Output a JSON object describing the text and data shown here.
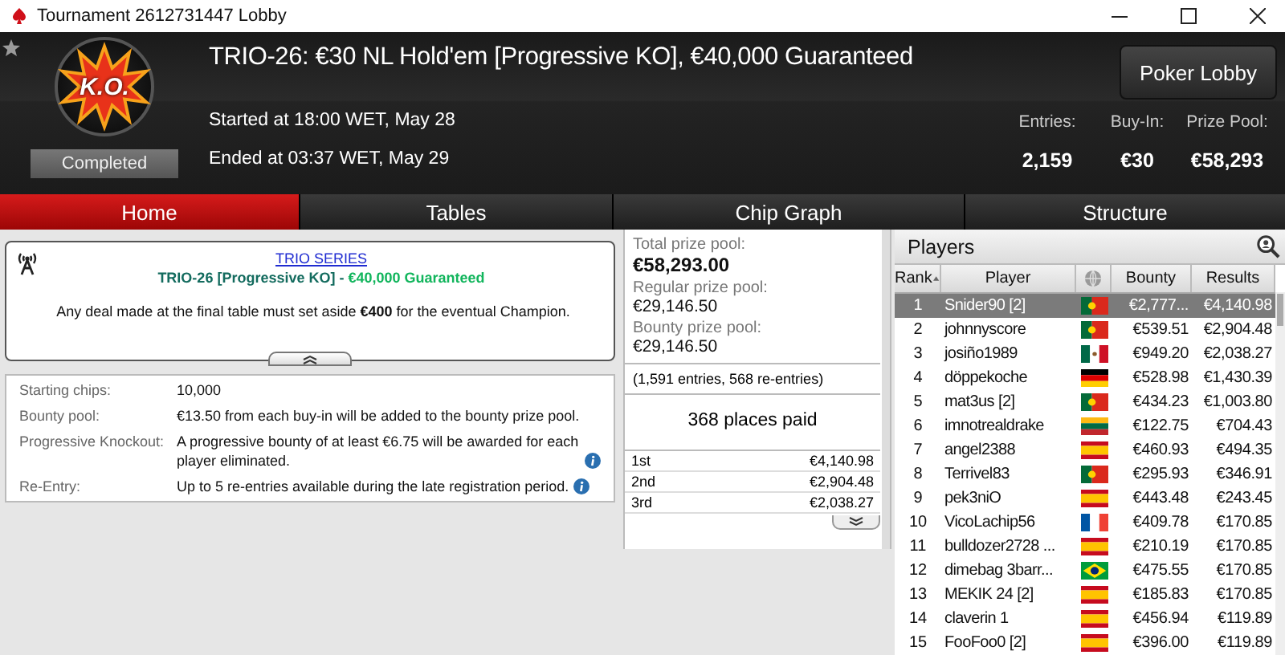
{
  "window": {
    "title": "Tournament 2612731447 Lobby"
  },
  "header": {
    "logo_text": "K.O.",
    "status": "Completed",
    "title": "TRIO-26: €30 NL Hold'em [Progressive KO], €40,000 Guaranteed",
    "started": "Started at 18:00 WET, May 28",
    "ended": "Ended at 03:37 WET, May 29",
    "button": "Poker Lobby",
    "stats": [
      {
        "label": "Entries:",
        "value": "2,159"
      },
      {
        "label": "Buy-In:",
        "value": "€30"
      },
      {
        "label": "Prize Pool:",
        "value": "€58,293"
      }
    ]
  },
  "tabs": [
    {
      "label": "Home",
      "selected": true
    },
    {
      "label": "Tables",
      "selected": false
    },
    {
      "label": "Chip Graph",
      "selected": false
    },
    {
      "label": "Structure",
      "selected": false
    }
  ],
  "announcement": {
    "link": "TRIO SERIES",
    "subtitle": "TRIO-26 [Progressive KO] -",
    "guarantee": "€40,000 Guaranteed",
    "message": "Any deal made at the final table must set aside **€400** for the eventual Champion."
  },
  "details": [
    {
      "label": "Starting chips:",
      "value": "10,000",
      "info": false
    },
    {
      "label": "Bounty pool:",
      "value": "€13.50 from each buy-in will be added to the bounty prize pool.",
      "info": false
    },
    {
      "label": "Progressive Knockout:",
      "value": "A progressive bounty of at least €6.75 will be awarded for each player eliminated.",
      "info": true
    },
    {
      "label": "Re-Entry:",
      "value": "Up to 5 re-entries available during the late registration period.",
      "info": true
    }
  ],
  "prize_pool": {
    "pools": [
      {
        "label": "Total prize pool:",
        "value": "€58,293.00",
        "kind": "total"
      },
      {
        "label": "Regular prize pool:",
        "value": "€29,146.50",
        "kind": "sub"
      },
      {
        "label": "Bounty prize pool:",
        "value": "€29,146.50",
        "kind": "sub"
      }
    ],
    "entries_note": "(1,591 entries, 568 re-entries)",
    "places_paid": "368 places paid",
    "payouts": [
      {
        "place": "1st",
        "amount": "€4,140.98"
      },
      {
        "place": "2nd",
        "amount": "€2,904.48"
      },
      {
        "place": "3rd",
        "amount": "€2,038.27"
      }
    ]
  },
  "players": {
    "title": "Players",
    "columns": [
      "Rank",
      "Player",
      "Bounty",
      "Results"
    ],
    "rows": [
      {
        "rank": "1",
        "player": "Snider90 [2]",
        "kind": "portugal",
        "bounty": "€2,777...",
        "result": "€4,140.98",
        "selected": true
      },
      {
        "rank": "2",
        "player": "johnnyscore",
        "kind": "portugal",
        "bounty": "€539.51",
        "result": "€2,904.48",
        "selected": false
      },
      {
        "rank": "3",
        "player": "josiño1989",
        "kind": "mexico",
        "bounty": "€949.20",
        "result": "€2,038.27",
        "selected": false
      },
      {
        "rank": "4",
        "player": "döppekoche",
        "kind": "germany",
        "bounty": "€528.98",
        "result": "€1,430.39",
        "selected": false
      },
      {
        "rank": "5",
        "player": "mat3us [2]",
        "kind": "portugal",
        "bounty": "€434.23",
        "result": "€1,003.80",
        "selected": false
      },
      {
        "rank": "6",
        "player": "imnotrealdrake",
        "kind": "lithuania",
        "bounty": "€122.75",
        "result": "€704.43",
        "selected": false
      },
      {
        "rank": "7",
        "player": "angel2388",
        "kind": "spain",
        "bounty": "€460.93",
        "result": "€494.35",
        "selected": false
      },
      {
        "rank": "8",
        "player": "Terrivel83",
        "kind": "portugal",
        "bounty": "€295.93",
        "result": "€346.91",
        "selected": false
      },
      {
        "rank": "9",
        "player": "pek3niO",
        "kind": "spain",
        "bounty": "€443.48",
        "result": "€243.45",
        "selected": false
      },
      {
        "rank": "10",
        "player": "VicoLachip56",
        "kind": "france",
        "bounty": "€409.78",
        "result": "€170.85",
        "selected": false
      },
      {
        "rank": "11",
        "player": "bulldozer2728 ...",
        "kind": "spain",
        "bounty": "€210.19",
        "result": "€170.85",
        "selected": false
      },
      {
        "rank": "12",
        "player": "dimebag 3barr...",
        "kind": "brazil",
        "bounty": "€475.55",
        "result": "€170.85",
        "selected": false
      },
      {
        "rank": "13",
        "player": "MEKIK 24 [2]",
        "kind": "spain",
        "bounty": "€185.83",
        "result": "€170.85",
        "selected": false
      },
      {
        "rank": "14",
        "player": "claverin 1",
        "kind": "spain",
        "bounty": "€456.94",
        "result": "€119.89",
        "selected": false
      },
      {
        "rank": "15",
        "player": "FooFoo0 [2]",
        "kind": "spain",
        "bounty": "€396.00",
        "result": "€119.89",
        "selected": false
      }
    ]
  }
}
